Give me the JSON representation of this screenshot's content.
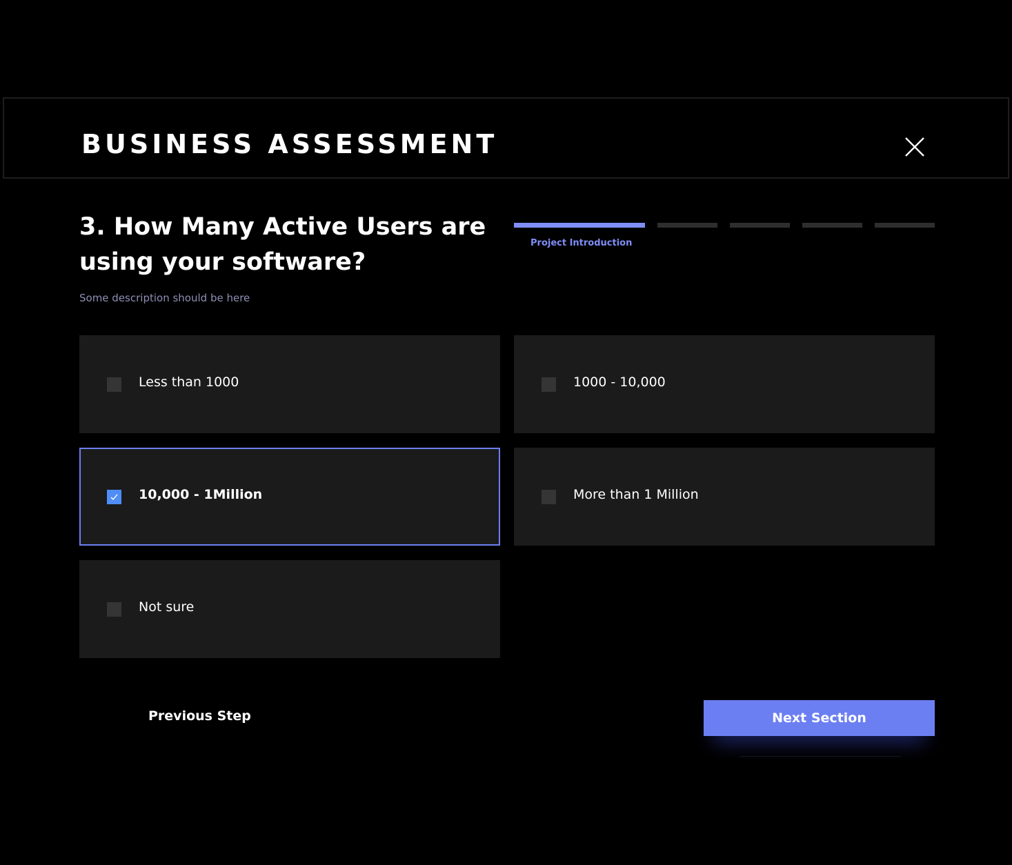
{
  "header": {
    "title": "BUSINESS ASSESSMENT",
    "close_icon": "close-icon"
  },
  "question": {
    "text": "3. How Many Active Users are using your software?",
    "description": "Some description should be here"
  },
  "progress": {
    "active_label": "Project Introduction",
    "total_steps": 5,
    "current_step": 1,
    "active_color": "#7f8ef7",
    "inactive_color": "#2e2e2e"
  },
  "options": [
    {
      "label": "Less than 1000",
      "selected": false
    },
    {
      "label": "1000 - 10,000",
      "selected": false
    },
    {
      "label": "10,000 - 1Million",
      "selected": true
    },
    {
      "label": "More than 1 Million",
      "selected": false
    },
    {
      "label": "Not sure",
      "selected": false
    }
  ],
  "footer": {
    "previous_label": "Previous Step",
    "next_label": "Next Section"
  },
  "colors": {
    "accent": "#6b7ff2",
    "checkbox_checked": "#4f8df7",
    "option_background": "#1b1b1c",
    "background": "#000000"
  }
}
